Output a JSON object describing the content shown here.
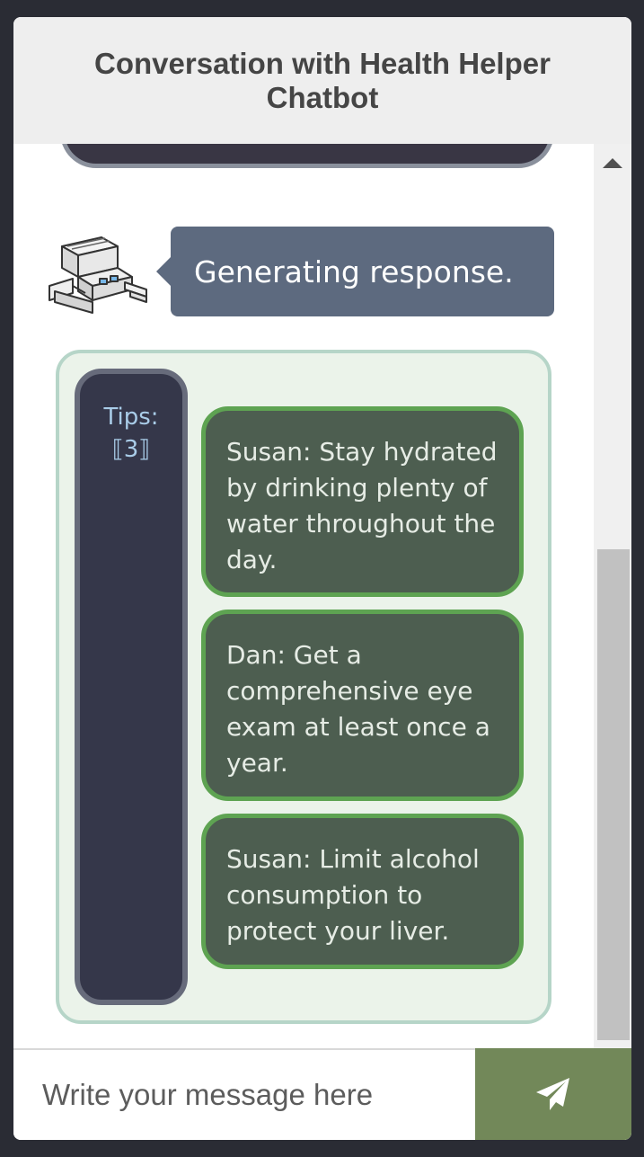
{
  "header": {
    "title": "Conversation with Health Helper Chatbot"
  },
  "bot_message": {
    "text": "Generating response."
  },
  "tips": {
    "label": "Tips:",
    "count_badge": "⟦3⟧",
    "items": [
      {
        "text": "Susan: Stay hydrated by drinking plenty of water throughout the day."
      },
      {
        "text": "Dan: Get a comprehensive eye exam at least once a year."
      },
      {
        "text": "Susan: Limit alcohol consumption to protect your liver."
      }
    ]
  },
  "composer": {
    "placeholder": "Write your message here",
    "value": "",
    "send_icon": "paper-plane-icon"
  },
  "colors": {
    "bot_bubble": "#5d6a7f",
    "tip_bubble": "#4d5e50",
    "tip_border": "#5ea352",
    "send_button": "#728859"
  }
}
